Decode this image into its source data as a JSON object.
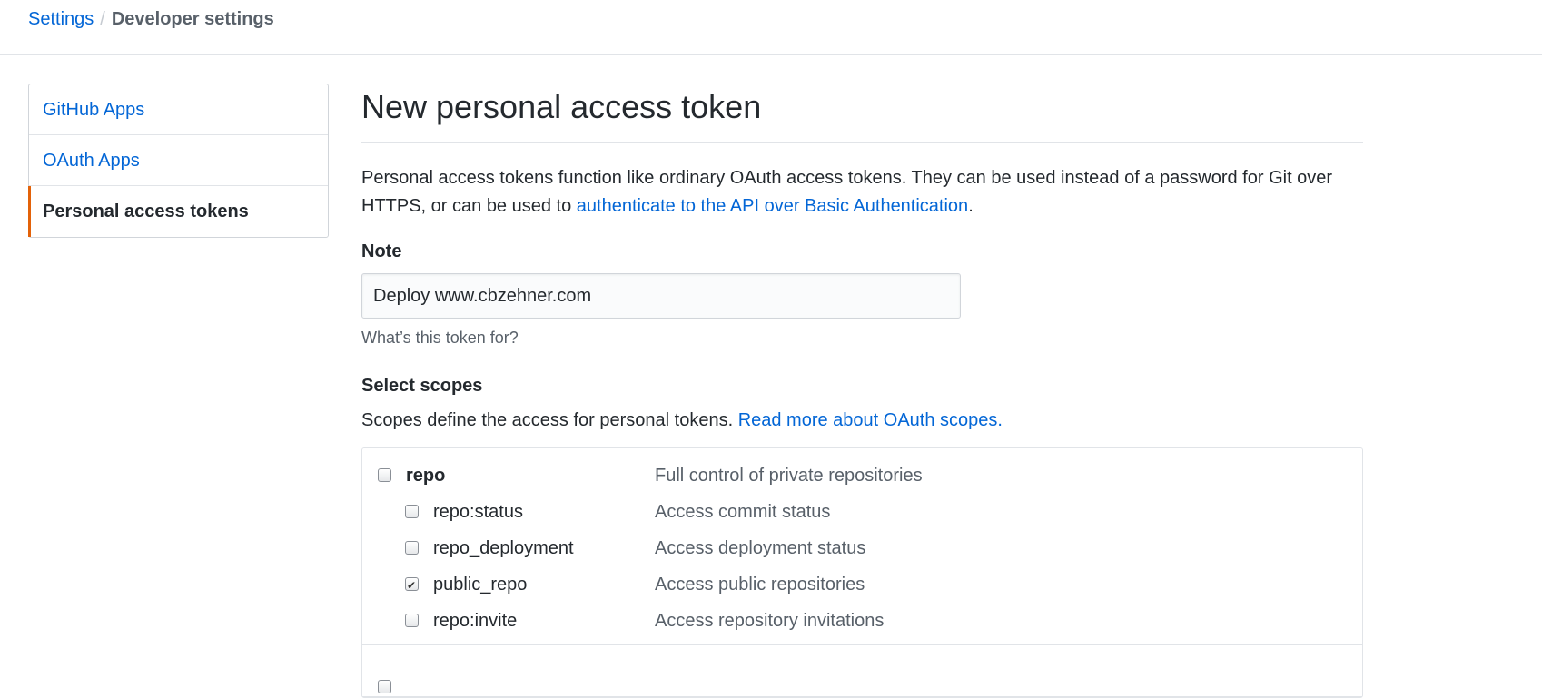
{
  "breadcrumb": {
    "settings": "Settings",
    "separator": "/",
    "current": "Developer settings"
  },
  "menu": {
    "items": [
      {
        "label": "GitHub Apps"
      },
      {
        "label": "OAuth Apps"
      },
      {
        "label": "Personal access tokens",
        "selected": true
      }
    ],
    "accent_color": "#e36209"
  },
  "page": {
    "title": "New personal access token",
    "intro_text": "Personal access tokens function like ordinary OAuth access tokens. They can be used instead of a password for Git over HTTPS, or can be used to ",
    "intro_link": "authenticate to the API over Basic Authentication",
    "intro_end": "."
  },
  "note": {
    "label": "Note",
    "value": "Deploy www.cbzehner.com",
    "hint": "What’s this token for?"
  },
  "scopes": {
    "title": "Select scopes",
    "desc": "Scopes define the access for personal tokens. ",
    "link": "Read more about OAuth scopes.",
    "repo": {
      "name": "repo",
      "desc": "Full control of private repositories",
      "checked": false,
      "children": [
        {
          "name": "repo:status",
          "desc": "Access commit status",
          "checked": false
        },
        {
          "name": "repo_deployment",
          "desc": "Access deployment status",
          "checked": false
        },
        {
          "name": "public_repo",
          "desc": "Access public repositories",
          "checked": true
        },
        {
          "name": "repo:invite",
          "desc": "Access repository invitations",
          "checked": false
        }
      ]
    }
  },
  "link_color": "#0366d6"
}
